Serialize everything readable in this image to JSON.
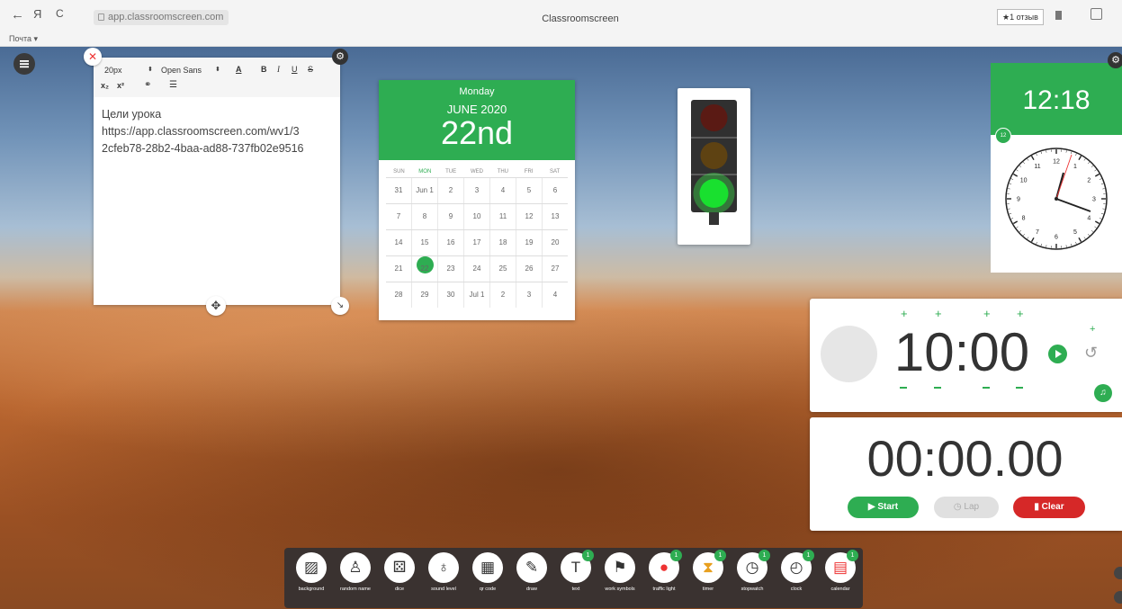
{
  "browser": {
    "back": "←",
    "yandex": "Я",
    "reload": "C",
    "url": "app.classroomscreen.com",
    "page_title": "Classroomscreen",
    "reviews": "★1 отзыв",
    "bookmark_bar": "Почта ▾"
  },
  "text_widget": {
    "font_size": "20px",
    "font_name": "Open Sans",
    "content_line1": "Цели урока",
    "content_line2": "https://app.classroomscreen.com/wv1/3",
    "content_line3": "2cfeb78-28b2-4baa-ad88-737fb02e9516"
  },
  "calendar": {
    "weekday": "Monday",
    "month_year": "JUNE 2020",
    "day": "22nd",
    "dow": [
      "SUN",
      "MON",
      "TUE",
      "WED",
      "THU",
      "FRI",
      "SAT"
    ],
    "weeks": [
      [
        "31",
        "Jun 1",
        "2",
        "3",
        "4",
        "5",
        "6"
      ],
      [
        "7",
        "8",
        "9",
        "10",
        "11",
        "12",
        "13"
      ],
      [
        "14",
        "15",
        "16",
        "17",
        "18",
        "19",
        "20"
      ],
      [
        "21",
        "22",
        "23",
        "24",
        "25",
        "26",
        "27"
      ],
      [
        "28",
        "29",
        "30",
        "Jul 1",
        "2",
        "3",
        "4"
      ]
    ],
    "selected_day": "22"
  },
  "traffic_light": {
    "active": "green",
    "colors": {
      "red": "#5a1a14",
      "yellow": "#5e4212",
      "green": "#19e02f"
    }
  },
  "clock": {
    "digital_time": "12:18",
    "badge": "12",
    "numbers": [
      "1",
      "2",
      "3",
      "4",
      "5",
      "6",
      "7",
      "8",
      "9",
      "10",
      "11",
      "12"
    ]
  },
  "timer": {
    "display": "10:00"
  },
  "stopwatch": {
    "display": "00:00.00",
    "start": "Start",
    "lap": "Lap",
    "clear": "Clear"
  },
  "dock": [
    {
      "label": "background",
      "icon": "background-icon",
      "badge": ""
    },
    {
      "label": "random name",
      "icon": "random-name-icon",
      "badge": ""
    },
    {
      "label": "dice",
      "icon": "dice-icon",
      "badge": ""
    },
    {
      "label": "sound level",
      "icon": "microphone-icon",
      "badge": ""
    },
    {
      "label": "qr code",
      "icon": "qr-code-icon",
      "badge": ""
    },
    {
      "label": "draw",
      "icon": "pencil-icon",
      "badge": ""
    },
    {
      "label": "text",
      "icon": "text-icon",
      "badge": "1"
    },
    {
      "label": "work symbols",
      "icon": "work-symbols-icon",
      "badge": ""
    },
    {
      "label": "traffic light",
      "icon": "traffic-light-icon",
      "badge": "1"
    },
    {
      "label": "timer",
      "icon": "hourglass-icon",
      "badge": "1"
    },
    {
      "label": "stopwatch",
      "icon": "stopwatch-icon",
      "badge": "1"
    },
    {
      "label": "clock",
      "icon": "clock-icon",
      "badge": "1"
    },
    {
      "label": "calendar",
      "icon": "calendar-icon",
      "badge": "1"
    }
  ],
  "colors": {
    "accent": "#2ead52",
    "clear": "#d62828",
    "lap": "#e0e0e0"
  }
}
